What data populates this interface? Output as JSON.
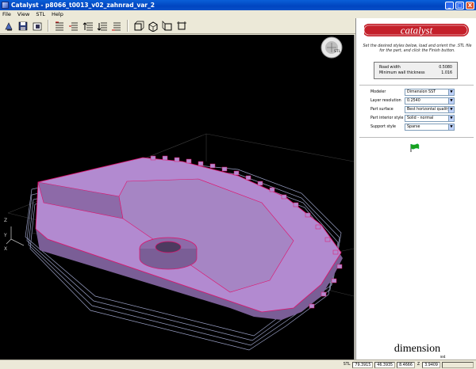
{
  "window": {
    "title": "Catalyst - p8066_t0013_v02_zahnrad_var_2",
    "minimize": "_",
    "maximize": "□",
    "close": "X"
  },
  "menu": [
    "File",
    "View",
    "STL",
    "Help"
  ],
  "toolbar": [
    {
      "name": "orient-icon"
    },
    {
      "name": "save-icon"
    },
    {
      "name": "print-icon"
    },
    {
      "name": "slice-view-icon"
    },
    {
      "name": "layer-toolpath-icon"
    },
    {
      "name": "layer-up-icon"
    },
    {
      "name": "layer-down-icon"
    },
    {
      "name": "layer-list-icon"
    },
    {
      "name": "view-front-icon"
    },
    {
      "name": "view-iso-icon"
    },
    {
      "name": "view-side-icon"
    },
    {
      "name": "view-top-icon"
    }
  ],
  "viewport": {
    "axis_z": "Z",
    "axis_y": "Y",
    "axis_x": "X",
    "nav_label": "STL"
  },
  "panel": {
    "logo": "catalyst",
    "instructions": "Set the desired styles below, load and orient the .STL file for the part, and click the Finish button.",
    "info": [
      {
        "label": "Road width",
        "value": "0.5080"
      },
      {
        "label": "Minimum wall thickness",
        "value": "1.016"
      }
    ],
    "fields": [
      {
        "label": "Modeler",
        "value": "Dimension SST"
      },
      {
        "label": "Layer resolution",
        "value": "0.2540"
      },
      {
        "label": "Part surface",
        "value": "Best horizontal quality"
      },
      {
        "label": "Part interior style",
        "value": "Solid - normal"
      },
      {
        "label": "Support style",
        "value": "Sparse"
      }
    ],
    "brand": "dimension",
    "brand_sub": "sst"
  },
  "status": {
    "label": "STL",
    "x": "79.3915",
    "y": "46.3935",
    "z": "8.4666",
    "z_label": "Z",
    "extra": "3.9409"
  },
  "colors": {
    "viewport_bg": "#000000",
    "part_fill": "#b28ad0",
    "part_edge": "#e0106a",
    "support": "#9aa0c6"
  }
}
